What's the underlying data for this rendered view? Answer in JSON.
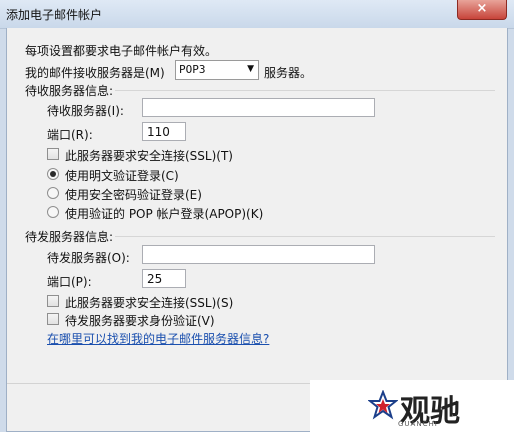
{
  "window": {
    "title": "添加电子邮件帐户",
    "close_icon": "×"
  },
  "intro": "每项设置都要求电子邮件帐户有效。",
  "server_type": {
    "label_prefix": "我的邮件接收服务器是(M)",
    "selected": "POP3",
    "label_suffix": "服务器。"
  },
  "incoming": {
    "heading": "待收服务器信息:",
    "server_label": "待收服务器(I):",
    "server_value": "",
    "port_label": "端口(R):",
    "port_value": "110",
    "ssl_label": "此服务器要求安全连接(SSL)(T)",
    "auth_options": [
      {
        "label": "使用明文验证登录(C)",
        "selected": true
      },
      {
        "label": "使用安全密码验证登录(E)",
        "selected": false
      },
      {
        "label": "使用验证的 POP 帐户登录(APOP)(K)",
        "selected": false
      }
    ]
  },
  "outgoing": {
    "heading": "待发服务器信息:",
    "server_label": "待发服务器(O):",
    "server_value": "",
    "port_label": "端口(P):",
    "port_value": "25",
    "ssl_label": "此服务器要求安全连接(SSL)(S)",
    "auth_label": "待发服务器要求身份验证(V)"
  },
  "help_link": "在哪里可以找到我的电子邮件服务器信息?",
  "watermark": {
    "text": "观驰",
    "sub": "GUANCHI"
  }
}
